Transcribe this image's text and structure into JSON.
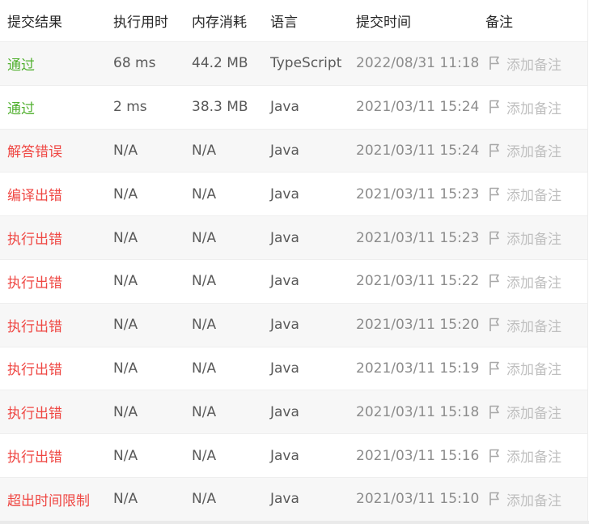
{
  "header": {
    "status": "提交结果",
    "runtime": "执行用时",
    "memory": "内存消耗",
    "language": "语言",
    "submitted_at": "提交时间",
    "note": "备注"
  },
  "rows": [
    {
      "status": "通过",
      "status_type": "pass",
      "runtime": "68 ms",
      "memory": "44.2 MB",
      "language": "TypeScript",
      "submitted_at": "2022/08/31 11:18",
      "note": "添加备注"
    },
    {
      "status": "通过",
      "status_type": "pass",
      "runtime": "2 ms",
      "memory": "38.3 MB",
      "language": "Java",
      "submitted_at": "2021/03/11 15:24",
      "note": "添加备注"
    },
    {
      "status": "解答错误",
      "status_type": "fail",
      "runtime": "N/A",
      "memory": "N/A",
      "language": "Java",
      "submitted_at": "2021/03/11 15:24",
      "note": "添加备注"
    },
    {
      "status": "编译出错",
      "status_type": "fail",
      "runtime": "N/A",
      "memory": "N/A",
      "language": "Java",
      "submitted_at": "2021/03/11 15:23",
      "note": "添加备注"
    },
    {
      "status": "执行出错",
      "status_type": "fail",
      "runtime": "N/A",
      "memory": "N/A",
      "language": "Java",
      "submitted_at": "2021/03/11 15:23",
      "note": "添加备注"
    },
    {
      "status": "执行出错",
      "status_type": "fail",
      "runtime": "N/A",
      "memory": "N/A",
      "language": "Java",
      "submitted_at": "2021/03/11 15:22",
      "note": "添加备注"
    },
    {
      "status": "执行出错",
      "status_type": "fail",
      "runtime": "N/A",
      "memory": "N/A",
      "language": "Java",
      "submitted_at": "2021/03/11 15:20",
      "note": "添加备注"
    },
    {
      "status": "执行出错",
      "status_type": "fail",
      "runtime": "N/A",
      "memory": "N/A",
      "language": "Java",
      "submitted_at": "2021/03/11 15:19",
      "note": "添加备注"
    },
    {
      "status": "执行出错",
      "status_type": "fail",
      "runtime": "N/A",
      "memory": "N/A",
      "language": "Java",
      "submitted_at": "2021/03/11 15:18",
      "note": "添加备注"
    },
    {
      "status": "执行出错",
      "status_type": "fail",
      "runtime": "N/A",
      "memory": "N/A",
      "language": "Java",
      "submitted_at": "2021/03/11 15:16",
      "note": "添加备注"
    },
    {
      "status": "超出时间限制",
      "status_type": "fail",
      "runtime": "N/A",
      "memory": "N/A",
      "language": "Java",
      "submitted_at": "2021/03/11 15:10",
      "note": "添加备注"
    }
  ],
  "colors": {
    "pass": "#52b030",
    "fail": "#ef4743",
    "note": "#bfbfbf",
    "row_alt": "#f7f7f7"
  },
  "icons": {
    "note": "flag-icon"
  }
}
